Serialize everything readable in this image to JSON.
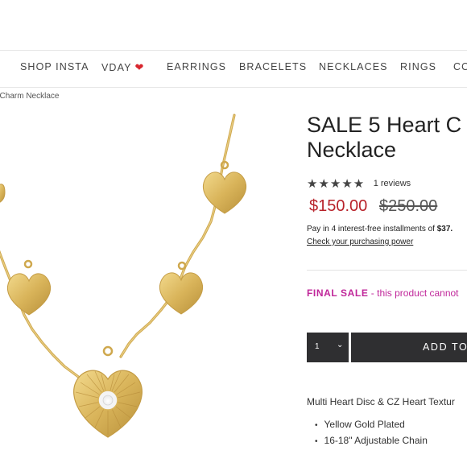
{
  "nav": {
    "items": [
      {
        "label": "SHOP INSTA"
      },
      {
        "label": "VDAY"
      },
      {
        "label": "EARRINGS"
      },
      {
        "label": "BRACELETS"
      },
      {
        "label": "NECKLACES"
      },
      {
        "label": "RINGS"
      },
      {
        "label": "CO"
      }
    ],
    "vday_icon": "red-heart-icon"
  },
  "breadcrumb": "t Charm Necklace",
  "product": {
    "title_line1": "SALE 5 Heart C",
    "title_line2": "Necklace",
    "rating": 5,
    "reviews": "1 reviews",
    "price": "$150.00",
    "compare_price": "$250.00",
    "pay_text": "Pay in 4 interest-free installments of ",
    "pay_amount": "$37.",
    "pay_link": "Check your purchasing power",
    "final_label": "FINAL SALE",
    "final_note": " - this product cannot",
    "quantity": "1",
    "add_label": "ADD TO",
    "description": "Multi Heart Disc & CZ Heart Textur",
    "features": [
      "Yellow Gold Plated",
      "16-18\" Adjustable Chain"
    ]
  },
  "colors": {
    "price_red": "#b8222a",
    "final_sale_magenta": "#c0279a",
    "button_dark": "#2f2f31",
    "gold": "#d9b45a"
  }
}
